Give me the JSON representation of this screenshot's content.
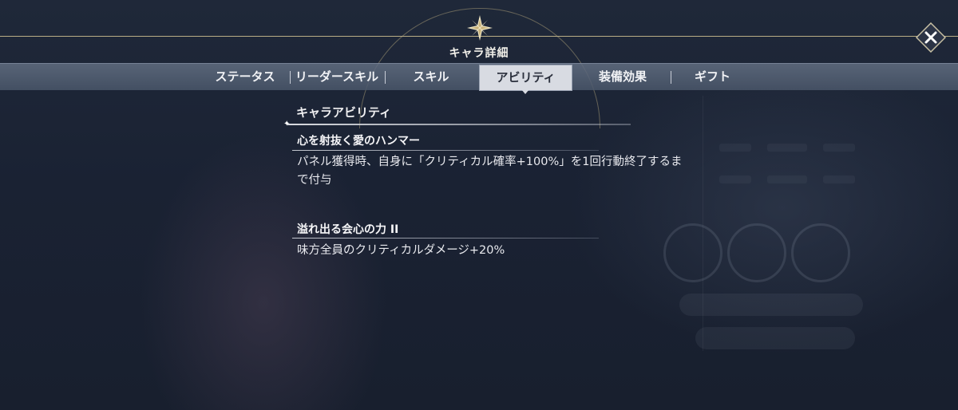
{
  "header": {
    "title": "キャラ詳細"
  },
  "tabs": [
    {
      "label": "ステータス",
      "active": false
    },
    {
      "label": "リーダースキル",
      "active": false
    },
    {
      "label": "スキル",
      "active": false
    },
    {
      "label": "アビリティ",
      "active": true
    },
    {
      "label": "装備効果",
      "active": false
    },
    {
      "label": "ギフト",
      "active": false
    }
  ],
  "section": {
    "title": "キャラアビリティ"
  },
  "abilities": [
    {
      "name": "心を射抜く愛のハンマー",
      "description": "パネル獲得時、自身に「クリティカル確率+100%」を1回行動終了するまで付与"
    },
    {
      "name": "溢れ出る会心の力 II",
      "description": "味方全員のクリティカルダメージ+20%"
    }
  ],
  "icons": {
    "close": "close-icon",
    "emblem": "compass-star-icon"
  }
}
